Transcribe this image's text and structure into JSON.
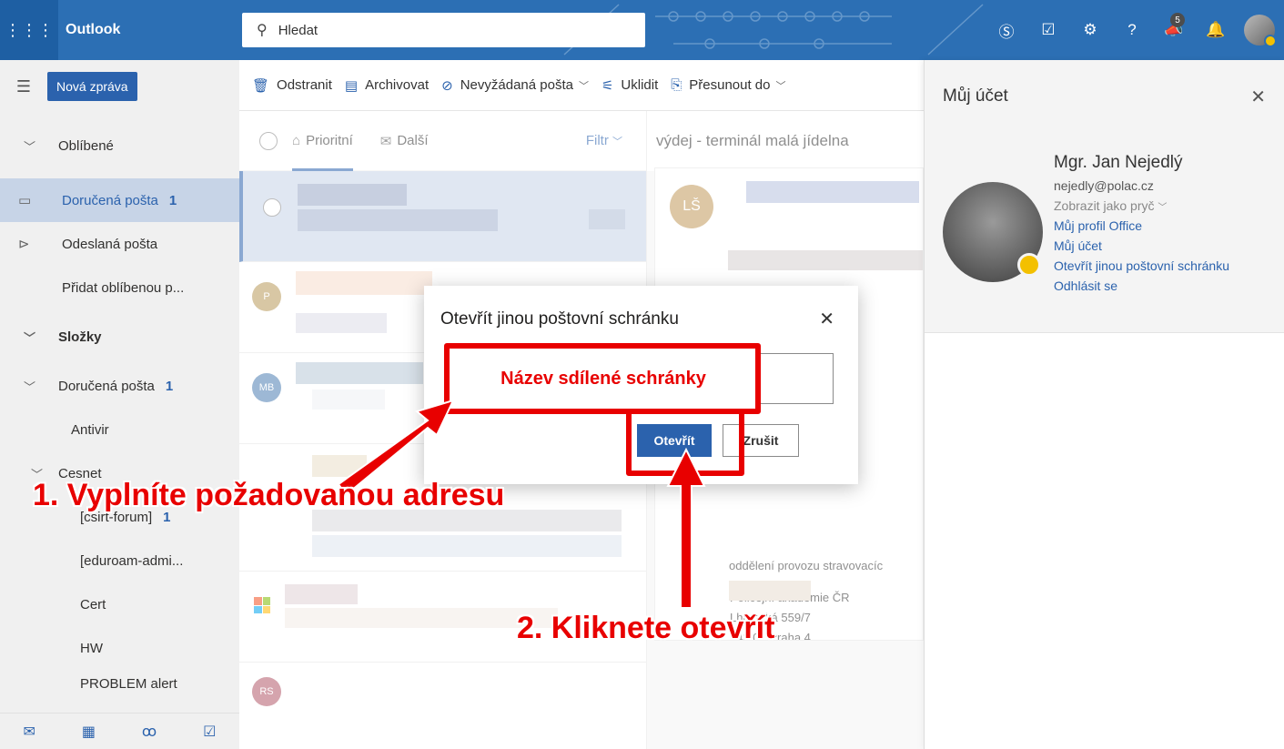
{
  "header": {
    "app_name": "Outlook",
    "search_placeholder": "Hledat",
    "notification_count": "5"
  },
  "nav": {
    "new_mail_label": "Nová zpráva",
    "favorites_label": "Oblíbené",
    "items": [
      {
        "label": "Doručená pošta",
        "count": "1"
      },
      {
        "label": "Odeslaná pošta"
      },
      {
        "label": "Přidat oblíbenou p..."
      }
    ],
    "folders_label": "Složky",
    "folders": [
      {
        "label": "Doručená pošta",
        "count": "1"
      },
      {
        "label": "Antivir"
      },
      {
        "label": "Cesnet"
      },
      {
        "label": "[csirt-forum]",
        "count": "1"
      },
      {
        "label": "[eduroam-admi..."
      },
      {
        "label": "Cert"
      },
      {
        "label": "HW"
      },
      {
        "label": "PROBLEM alert"
      }
    ]
  },
  "toolbar": {
    "delete": "Odstranit",
    "archive": "Archivovat",
    "junk": "Nevyžádaná pošta",
    "sweep": "Uklidit",
    "move": "Přesunout do"
  },
  "list": {
    "tab_focused": "Prioritní",
    "tab_other": "Další",
    "filter": "Filtr",
    "avatars": [
      "P",
      "MB",
      "RS"
    ]
  },
  "reading": {
    "subject": "výdej - terminál malá jídelna",
    "sender_initials": "LŠ",
    "sig_lines": [
      "Policejní akademie ČR",
      "Lhotecká 559/7",
      "143 01 Praha 4",
      "oddělení provozu stravovacíc"
    ]
  },
  "account": {
    "title": "Můj účet",
    "name": "Mgr. Jan Nejedlý",
    "email": "nejedly@polac.cz",
    "status": "Zobrazit jako pryč",
    "links": [
      "Můj profil Office",
      "Můj účet",
      "Otevřít jinou poštovní schránku",
      "Odhlásit se"
    ]
  },
  "dialog": {
    "title": "Otevřít jinou poštovní schránku",
    "input_annotation": "Název sdílené schránky",
    "open_button": "Otevřít",
    "cancel_button": "Zrušit"
  },
  "annotations": {
    "step1": "1. Vyplníte požadovanou adresu",
    "step2": "2. Kliknete otevřít",
    "accent_color": "#e80000"
  }
}
